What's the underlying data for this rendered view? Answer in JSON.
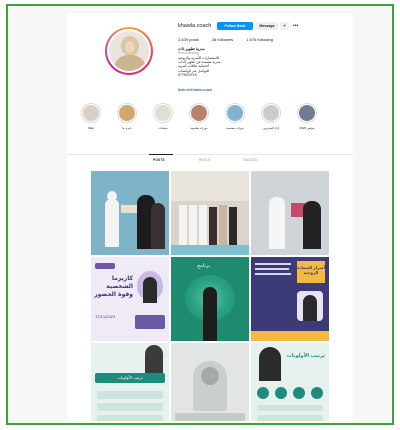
{
  "profile": {
    "username": "khawla.coach",
    "follow_label": "Follow Back",
    "message_label": "Message",
    "adduser_icon": "add-user-icon",
    "more_icon": "more-icon",
    "posts": "2,639 posts",
    "followers": "28 followers",
    "following": "1,676 following",
    "name": "مدربة تطوير ذات",
    "category": "Personal blog",
    "bio": [
      "للاستشارات الأسرية والزوجية",
      "مدربة معتمدة في تطوير الذات",
      "أخصائية علاقات أسرية",
      "للتواصل عبر الواتساب",
      "0775XXXXX"
    ],
    "link": "linktr.ee/khawla.coach"
  },
  "highlights": [
    {
      "label": "Map",
      "color": "#d8cfc6"
    },
    {
      "label": "عبرة بنا",
      "color": "#cfa86a"
    },
    {
      "label": "منتجات",
      "color": "#e0ddd5"
    },
    {
      "label": "دورات تعليمية",
      "color": "#b8816d"
    },
    {
      "label": "دورات معتمدة",
      "color": "#7fb3cf"
    },
    {
      "label": "آراء المتدربين",
      "color": "#c7ccd1"
    },
    {
      "label": "مؤتمر 2023",
      "color": "#6f7d93"
    }
  ],
  "tabs": {
    "posts": "POSTS",
    "reels": "REELS",
    "tagged": "TAGGED"
  },
  "posts": [
    {
      "title": "",
      "subtitle": "",
      "bg": "#7fb3c8"
    },
    {
      "title": "",
      "subtitle": "",
      "bg": "#d9d5cd"
    },
    {
      "title": "",
      "subtitle": "",
      "bg": "#cfd4d8"
    },
    {
      "title": "كاريزما الشخصية وقوة الحضور",
      "subtitle": "17/11/2023",
      "bg": "#efeaf5"
    },
    {
      "title": "برنامج",
      "subtitle": "",
      "bg": "#1e8a6e"
    },
    {
      "title": "أسرار السعادة الزوجية",
      "subtitle": "",
      "bg": "#3d3a78"
    },
    {
      "title": "ترتيب الأولويات",
      "subtitle": "",
      "bg": "#e7f1ef"
    },
    {
      "title": "",
      "subtitle": "",
      "bg": "#e2e5e4"
    },
    {
      "title": "ترتيب الأولويات",
      "subtitle": "",
      "bg": "#e7f1ef"
    }
  ]
}
